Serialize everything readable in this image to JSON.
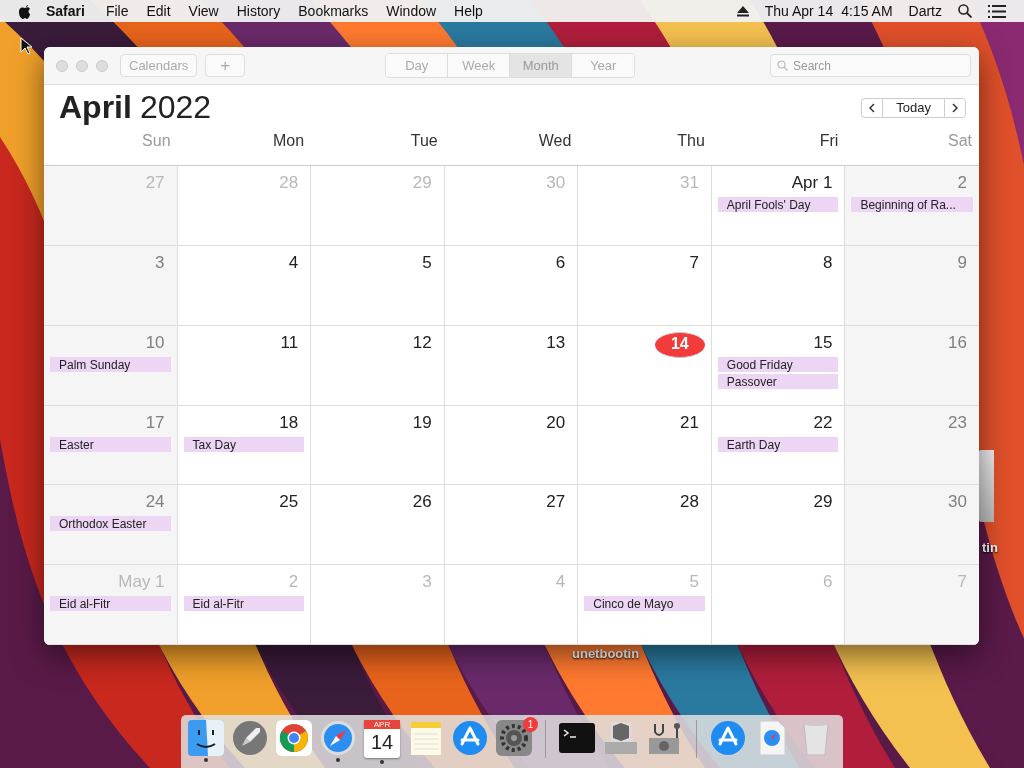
{
  "menu_bar": {
    "app": "Safari",
    "menus": [
      "File",
      "Edit",
      "View",
      "History",
      "Bookmarks",
      "Window",
      "Help"
    ],
    "clock_day": "Thu Apr 14",
    "clock_time": "4:15 AM",
    "user": "Dartz"
  },
  "desktop_icons": [
    {
      "label": "tin"
    },
    {
      "label": "unetbootin"
    }
  ],
  "calendar": {
    "toolbar": {
      "calendars_button": "Calendars",
      "add_button": "+",
      "view_tabs": [
        {
          "label": "Day",
          "selected": false
        },
        {
          "label": "Week",
          "selected": false
        },
        {
          "label": "Month",
          "selected": true
        },
        {
          "label": "Year",
          "selected": false
        }
      ],
      "search": {
        "placeholder": "Search"
      }
    },
    "month": "April",
    "year": "2022",
    "today_button": "Today",
    "weekdays": [
      {
        "label": "Sun",
        "weekend": true
      },
      {
        "label": "Mon",
        "weekend": false
      },
      {
        "label": "Tue",
        "weekend": false
      },
      {
        "label": "Wed",
        "weekend": false
      },
      {
        "label": "Thu",
        "weekend": false
      },
      {
        "label": "Fri",
        "weekend": false
      },
      {
        "label": "Sat",
        "weekend": true
      }
    ],
    "weeks": [
      {
        "days": [
          {
            "label": "27",
            "in_month": false,
            "today": false
          },
          {
            "label": "28",
            "in_month": false,
            "today": false
          },
          {
            "label": "29",
            "in_month": false,
            "today": false
          },
          {
            "label": "30",
            "in_month": false,
            "today": false
          },
          {
            "label": "31",
            "in_month": false,
            "today": false
          },
          {
            "label": "Apr 1",
            "in_month": true,
            "today": false,
            "events": [
              "April Fools' Day"
            ]
          },
          {
            "label": "2",
            "in_month": true,
            "today": false,
            "events": [
              "Beginning of Ra..."
            ]
          }
        ]
      },
      {
        "days": [
          {
            "label": "3",
            "in_month": true,
            "today": false
          },
          {
            "label": "4",
            "in_month": true,
            "today": false
          },
          {
            "label": "5",
            "in_month": true,
            "today": false
          },
          {
            "label": "6",
            "in_month": true,
            "today": false
          },
          {
            "label": "7",
            "in_month": true,
            "today": false
          },
          {
            "label": "8",
            "in_month": true,
            "today": false
          },
          {
            "label": "9",
            "in_month": true,
            "today": false
          }
        ]
      },
      {
        "days": [
          {
            "label": "10",
            "in_month": true,
            "today": false,
            "events": [
              "Palm Sunday"
            ]
          },
          {
            "label": "11",
            "in_month": true,
            "today": false
          },
          {
            "label": "12",
            "in_month": true,
            "today": false
          },
          {
            "label": "13",
            "in_month": true,
            "today": false
          },
          {
            "label": "14",
            "in_month": true,
            "today": true
          },
          {
            "label": "15",
            "in_month": true,
            "today": false,
            "events": [
              "Good Friday",
              "Passover"
            ]
          },
          {
            "label": "16",
            "in_month": true,
            "today": false
          }
        ]
      },
      {
        "days": [
          {
            "label": "17",
            "in_month": true,
            "today": false,
            "events": [
              "Easter"
            ]
          },
          {
            "label": "18",
            "in_month": true,
            "today": false,
            "events": [
              "Tax Day"
            ]
          },
          {
            "label": "19",
            "in_month": true,
            "today": false
          },
          {
            "label": "20",
            "in_month": true,
            "today": false
          },
          {
            "label": "21",
            "in_month": true,
            "today": false
          },
          {
            "label": "22",
            "in_month": true,
            "today": false,
            "events": [
              "Earth Day"
            ]
          },
          {
            "label": "23",
            "in_month": true,
            "today": false
          }
        ]
      },
      {
        "days": [
          {
            "label": "24",
            "in_month": true,
            "today": false,
            "events": [
              "Orthodox Easter"
            ]
          },
          {
            "label": "25",
            "in_month": true,
            "today": false
          },
          {
            "label": "26",
            "in_month": true,
            "today": false
          },
          {
            "label": "27",
            "in_month": true,
            "today": false
          },
          {
            "label": "28",
            "in_month": true,
            "today": false
          },
          {
            "label": "29",
            "in_month": true,
            "today": false
          },
          {
            "label": "30",
            "in_month": true,
            "today": false
          }
        ]
      },
      {
        "days": [
          {
            "label": "May 1",
            "in_month": false,
            "today": false,
            "events": [
              "Eid al-Fitr"
            ]
          },
          {
            "label": "2",
            "in_month": false,
            "today": false,
            "events": [
              "Eid al-Fitr"
            ]
          },
          {
            "label": "3",
            "in_month": false,
            "today": false
          },
          {
            "label": "4",
            "in_month": false,
            "today": false
          },
          {
            "label": "5",
            "in_month": false,
            "today": false,
            "events": [
              "Cinco de Mayo"
            ]
          },
          {
            "label": "6",
            "in_month": false,
            "today": false
          },
          {
            "label": "7",
            "in_month": false,
            "today": false
          }
        ]
      }
    ]
  },
  "dock": {
    "items": [
      {
        "kind": "finder",
        "running": true
      },
      {
        "kind": "launchpad",
        "running": false
      },
      {
        "kind": "chrome",
        "running": false
      },
      {
        "kind": "safari",
        "running": true
      },
      {
        "kind": "calendar",
        "running": true,
        "month": "APR",
        "day": "14"
      },
      {
        "kind": "notes",
        "running": false
      },
      {
        "kind": "appstore",
        "running": false
      },
      {
        "kind": "settings",
        "running": false,
        "badge": "1"
      },
      {
        "kind": "separator"
      },
      {
        "kind": "terminal",
        "running": false
      },
      {
        "kind": "bootcamp",
        "running": false
      },
      {
        "kind": "diskutility",
        "running": false
      },
      {
        "kind": "separator"
      },
      {
        "kind": "appstore",
        "running": false
      },
      {
        "kind": "download",
        "running": false
      },
      {
        "kind": "trash",
        "running": false
      }
    ]
  }
}
